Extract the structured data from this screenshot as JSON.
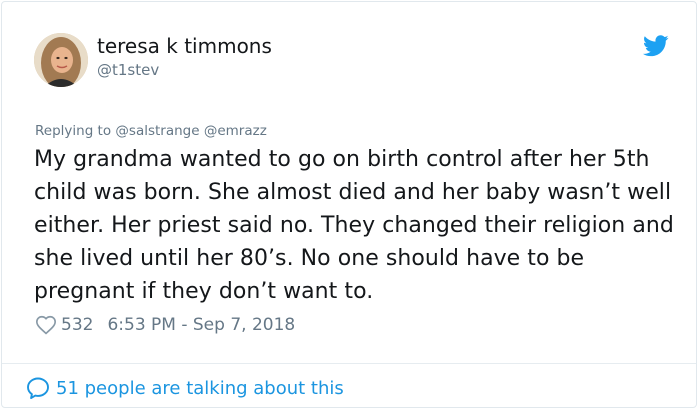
{
  "author": {
    "display_name": "teresa k timmons",
    "handle": "@t1stev",
    "avatar_icon": "avatar-photo"
  },
  "platform_icon": "twitter-bird-icon",
  "reply": {
    "prefix": "Replying to",
    "mentions": [
      "@salstrange",
      "@emrazz"
    ]
  },
  "tweet": {
    "text": "My grandma wanted to go on birth control after her 5th child was born. She almost died and her baby wasn’t well either. Her priest said no. They changed their religion and she lived until her 80’s. No one should have to be pregnant if they don’t want to."
  },
  "meta": {
    "likes": "532",
    "timestamp": "6:53 PM - Sep 7, 2018"
  },
  "footer": {
    "talking": "51 people are talking about this"
  },
  "colors": {
    "text": "#14171a",
    "muted": "#657786",
    "accent": "#1b95e0",
    "bird": "#1da1f2",
    "border": "#e1e8ed"
  }
}
